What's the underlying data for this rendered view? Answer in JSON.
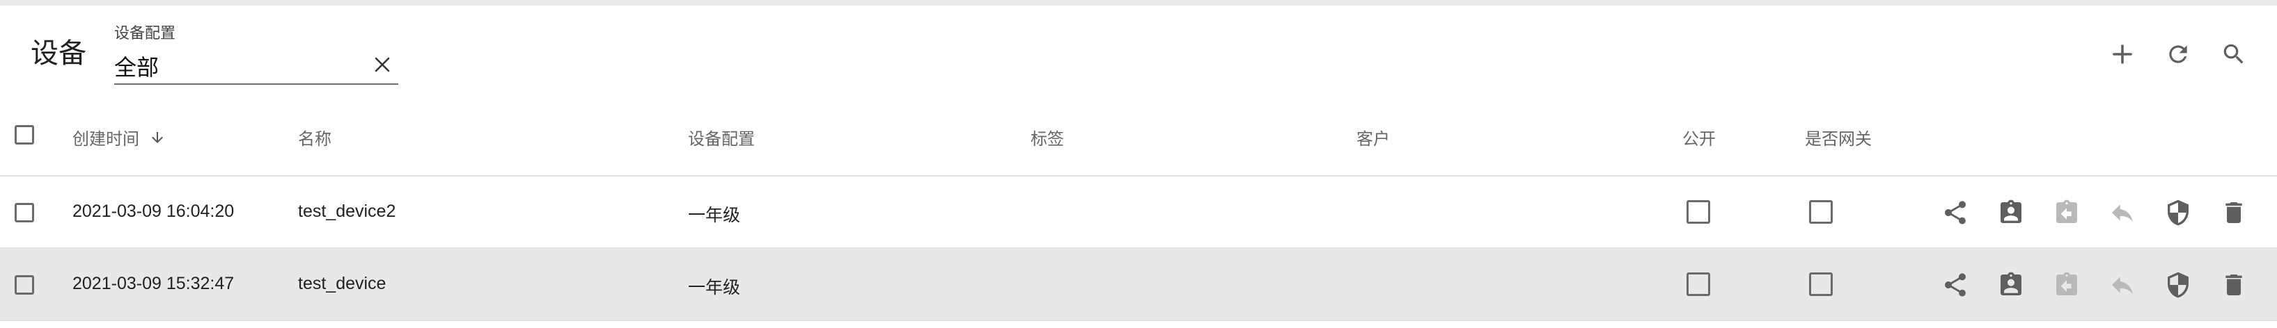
{
  "header": {
    "title": "设备",
    "filter": {
      "label": "设备配置",
      "value": "全部",
      "clear_icon": "close-icon"
    },
    "tools": [
      {
        "name": "add-button",
        "icon": "plus-icon"
      },
      {
        "name": "refresh-button",
        "icon": "refresh-icon"
      },
      {
        "name": "search-button",
        "icon": "search-icon"
      }
    ]
  },
  "table": {
    "columns": {
      "created_time": "创建时间",
      "name": "名称",
      "profile": "设备配置",
      "label": "标签",
      "customer": "客户",
      "public": "公开",
      "gateway": "是否网关"
    },
    "sort": {
      "column": "created_time",
      "direction": "descending",
      "icon": "arrow-down-icon"
    },
    "rows": [
      {
        "created_time": "2021-03-09 16:04:20",
        "name": "test_device2",
        "profile": "一年级",
        "label": "",
        "customer": "",
        "public": false,
        "gateway": false,
        "highlighted": false
      },
      {
        "created_time": "2021-03-09 15:32:47",
        "name": "test_device",
        "profile": "一年级",
        "label": "",
        "customer": "",
        "public": false,
        "gateway": false,
        "highlighted": true
      }
    ],
    "row_actions": [
      {
        "name": "share",
        "icon": "share-icon",
        "enabled": true
      },
      {
        "name": "assign-to-customer",
        "icon": "assignment-ind-icon",
        "enabled": true
      },
      {
        "name": "unassign-from-customer",
        "icon": "assignment-return-icon",
        "enabled": false
      },
      {
        "name": "make-private",
        "icon": "reply-icon",
        "enabled": false
      },
      {
        "name": "manage-credentials",
        "icon": "security-shield-icon",
        "enabled": true
      },
      {
        "name": "delete",
        "icon": "delete-icon",
        "enabled": true
      }
    ]
  },
  "colors": {
    "icon_enabled": "#5f5f5f",
    "icon_disabled": "#b9b9b9",
    "row_highlight": "#e8e8e8",
    "divider": "#e0e0e0"
  }
}
